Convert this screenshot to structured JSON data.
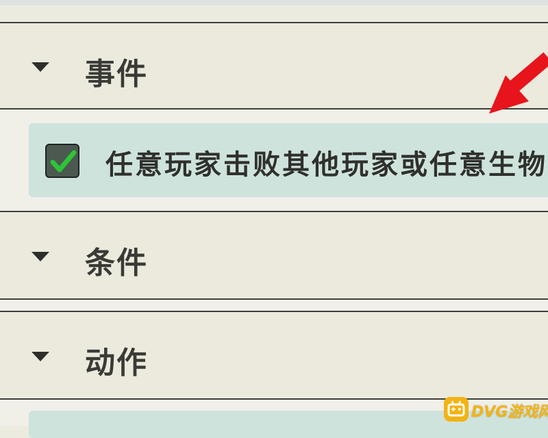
{
  "sections": {
    "event": {
      "label": "事件"
    },
    "condition": {
      "label": "条件"
    },
    "action": {
      "label": "动作"
    }
  },
  "event_item": {
    "text": "任意玩家击败其他玩家或任意生物",
    "checked": true
  },
  "colors": {
    "panel_bg": "#ebeadd",
    "border": "#3f3f3a",
    "row_bg": "#cfe3dd",
    "check_green": "#2fc437",
    "arrow_red": "#e8141c",
    "watermark": "#f2b313"
  },
  "icons": {
    "caret": "caret-down-icon",
    "check": "checkmark-icon",
    "arrow": "red-arrow-icon",
    "logo": "gamepad-logo-icon"
  },
  "watermark": {
    "text": "DVG游戏网"
  }
}
